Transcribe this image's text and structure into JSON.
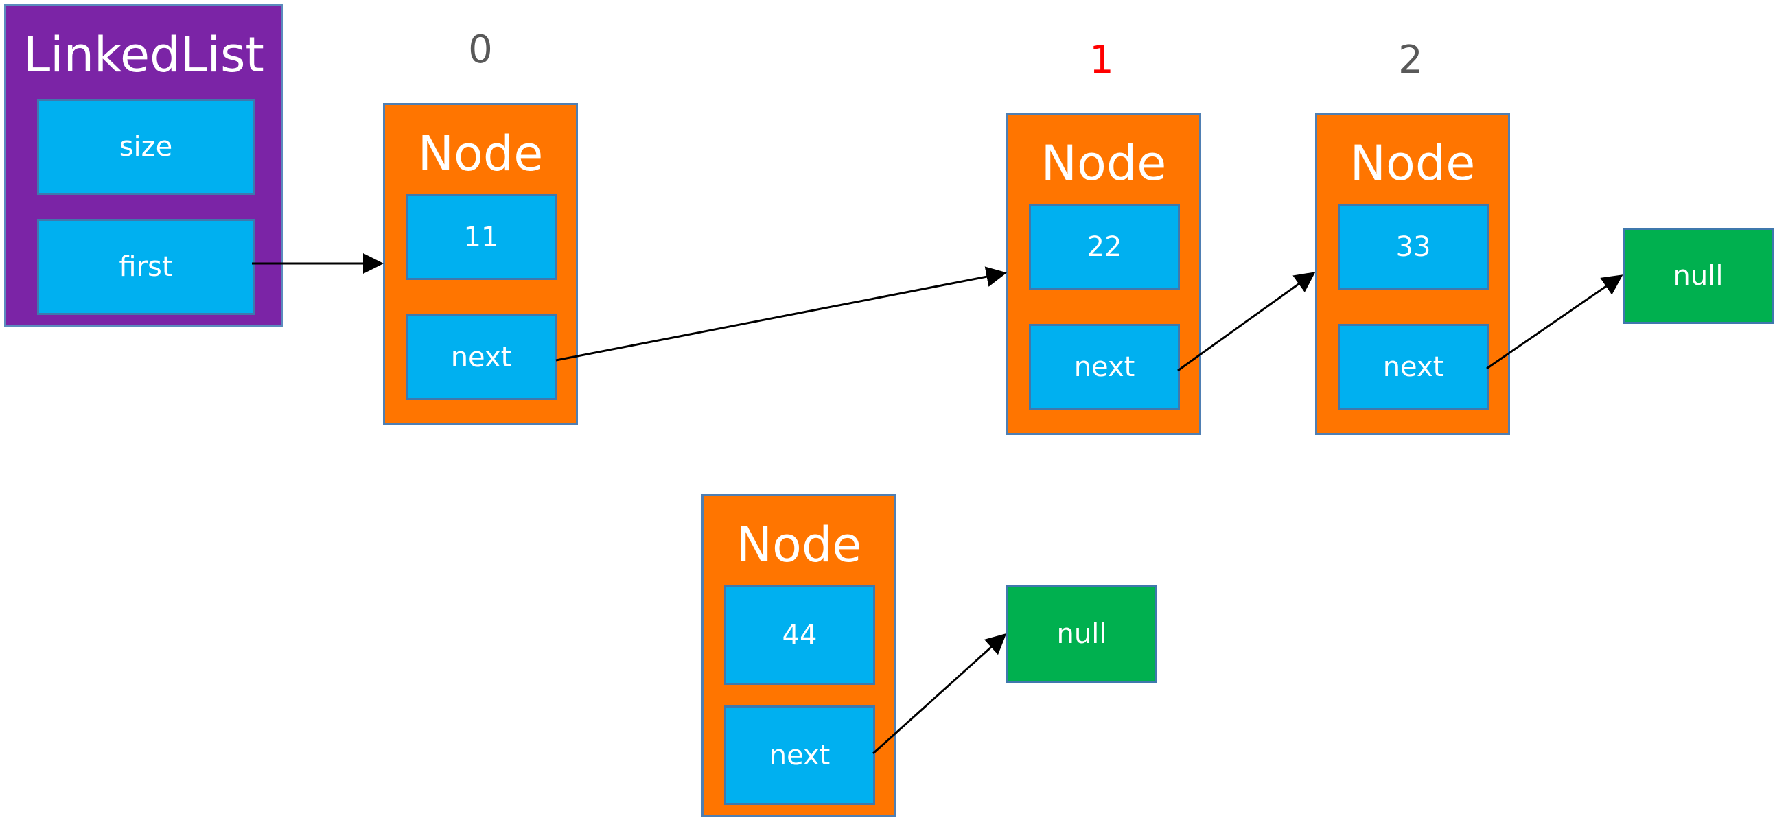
{
  "linked_list": {
    "title": "LinkedList",
    "fields": [
      "size",
      "first"
    ]
  },
  "nodes": [
    {
      "index_label": "0",
      "title": "Node",
      "value": "11",
      "next_label": "next"
    },
    {
      "index_label": "1",
      "title": "Node",
      "value": "22",
      "next_label": "next"
    },
    {
      "index_label": "2",
      "title": "Node",
      "value": "33",
      "next_label": "next"
    },
    {
      "index_label": "",
      "title": "Node",
      "value": "44",
      "next_label": "next"
    }
  ],
  "null_boxes": [
    "null",
    "null"
  ],
  "colors": {
    "linked_list": "#7b24a6",
    "node": "#ff7500",
    "field": "#00b0f0",
    "null": "#00b04f",
    "index_default": "#595959",
    "index_highlight": "#ff0000"
  },
  "highlighted_index": "1"
}
